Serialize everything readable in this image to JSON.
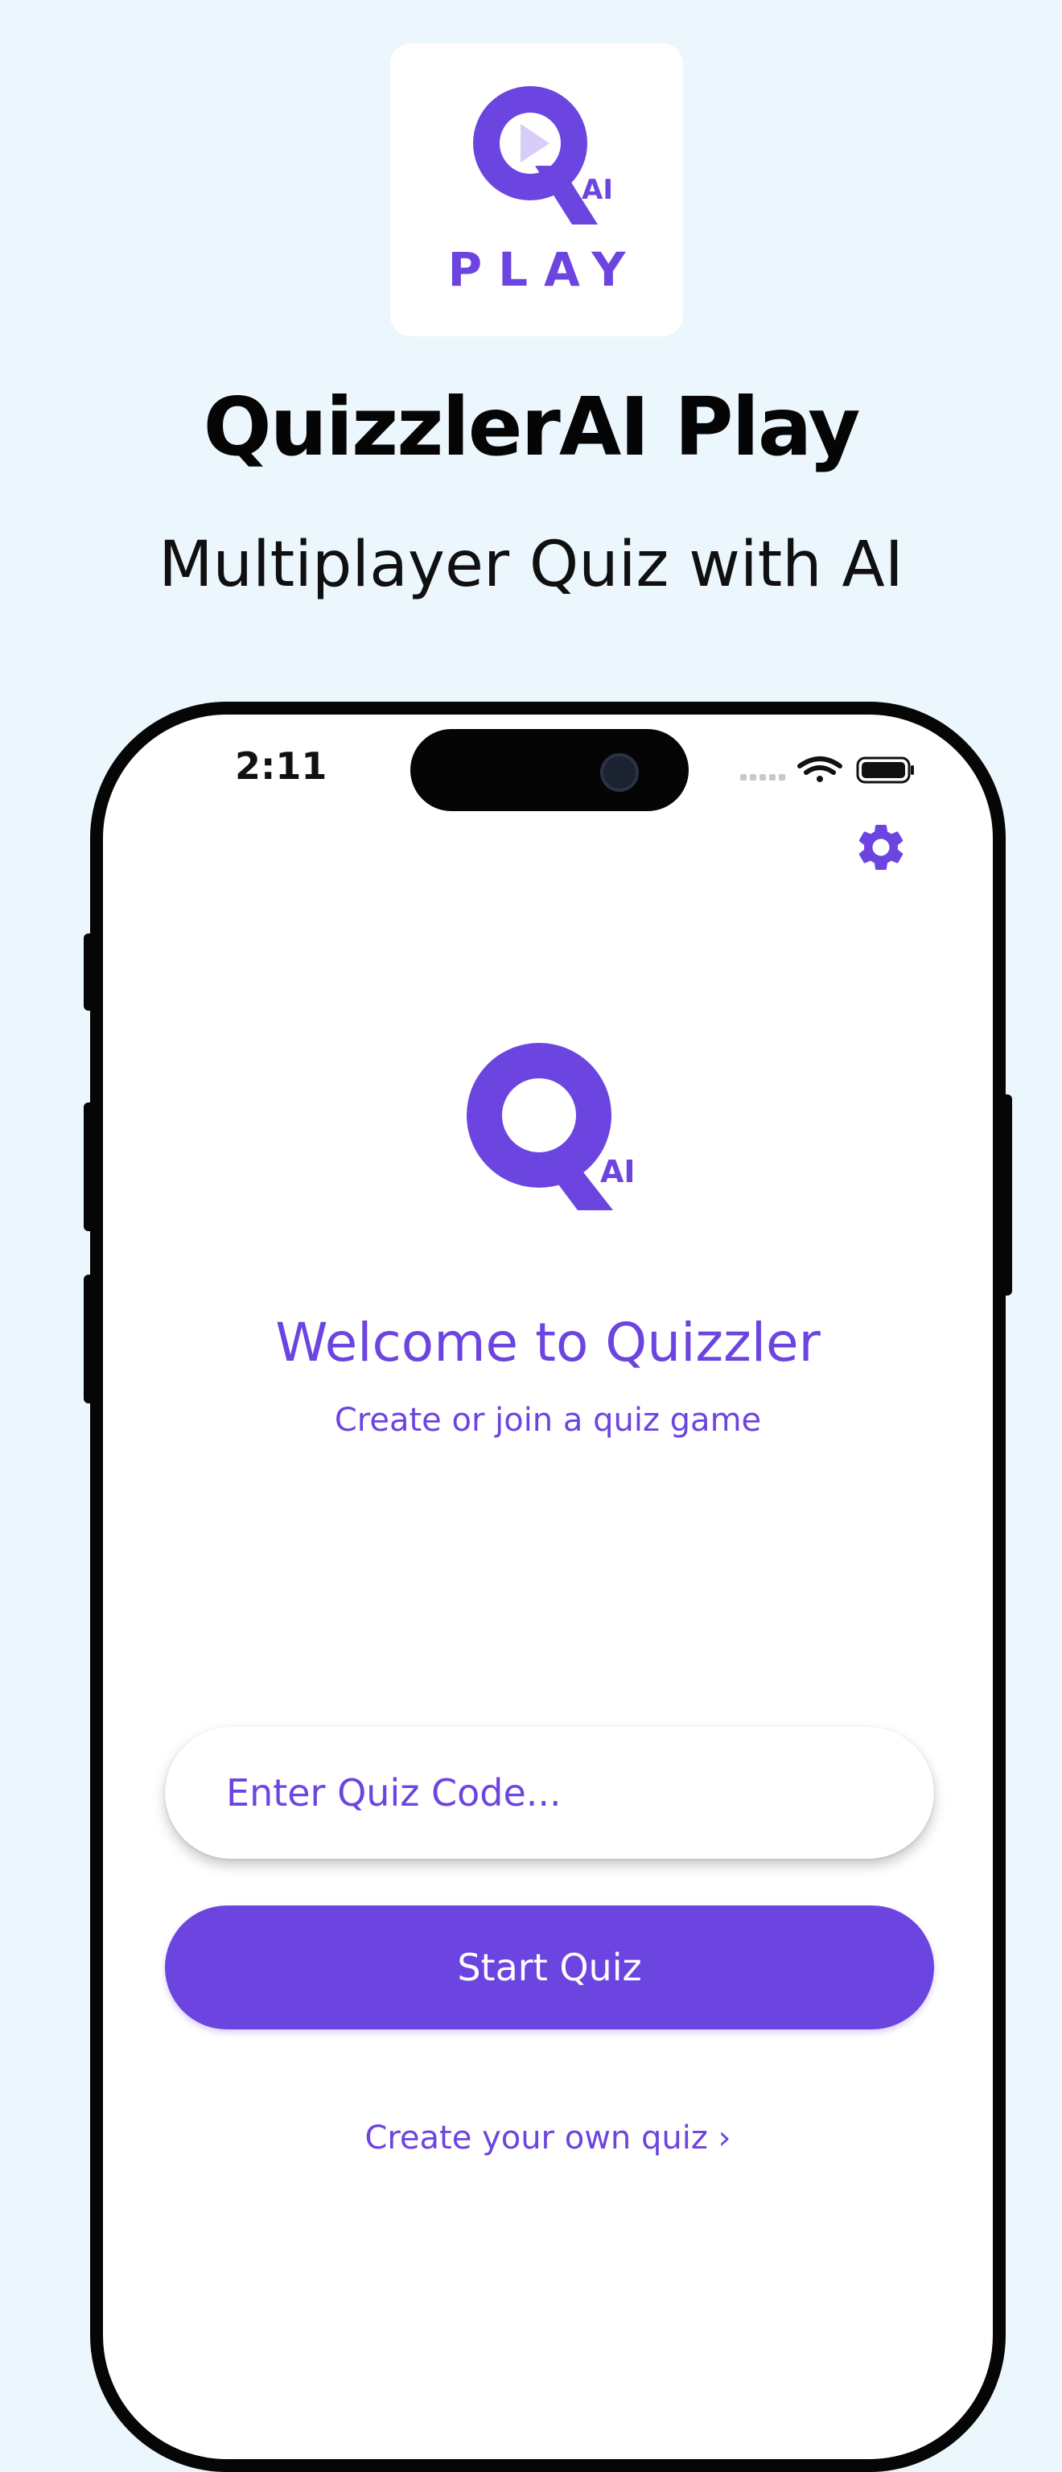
{
  "marketing": {
    "app_icon": {
      "icon": "quizzler-ai-play-logo",
      "badge": "AI",
      "word": "PLAY"
    },
    "title": "QuizzlerAI Play",
    "subtitle": "Multiplayer Quiz with AI"
  },
  "status_bar": {
    "time": "2:11",
    "icons": [
      "cellular-signal-icon",
      "wifi-icon",
      "battery-icon"
    ]
  },
  "header": {
    "settings_icon": "gear-icon"
  },
  "welcome": {
    "logo_badge": "AI",
    "title": "Welcome to Quizzler",
    "subtitle": "Create or join a quiz game"
  },
  "join": {
    "code_placeholder": "Enter Quiz Code...",
    "start_label": "Start Quiz"
  },
  "footer": {
    "create_link": "Create your own quiz ›"
  },
  "colors": {
    "background": "#ecf6fd",
    "accent": "#6c44e0",
    "accent_light": "#d8cdf8",
    "phone_frame": "#060606"
  }
}
